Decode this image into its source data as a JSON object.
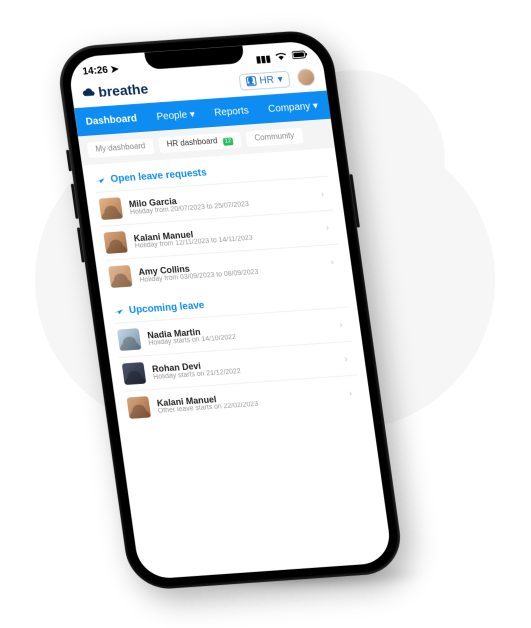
{
  "status_bar": {
    "time": "14:26",
    "location_icon": "location-arrow",
    "signal_icon": "signal",
    "wifi_icon": "wifi",
    "battery_icon": "battery"
  },
  "header": {
    "brand": "breathe",
    "role_selector": {
      "icon": "person",
      "label": "HR",
      "caret": "▾"
    }
  },
  "nav": {
    "items": [
      {
        "label": "Dashboard",
        "active": true
      },
      {
        "label": "People ▾"
      },
      {
        "label": "Reports"
      },
      {
        "label": "Company ▾"
      }
    ]
  },
  "sub_tabs": {
    "items": [
      {
        "label": "My dashboard",
        "active": false
      },
      {
        "label": "HR dashboard",
        "active": true,
        "badge": "12"
      },
      {
        "label": "Community",
        "active": false
      }
    ]
  },
  "sections": [
    {
      "icon": "plane",
      "title": "Open leave requests",
      "rows": [
        {
          "name": "Milo Garcia",
          "sub": "Holiday from 20/07/2023 to 25/07/2023",
          "avatar": "a1"
        },
        {
          "name": "Kalani Manuel",
          "sub": "Holiday from 12/11/2023 to 14/11/2023",
          "avatar": "a2"
        },
        {
          "name": "Amy Collins",
          "sub": "Holiday from 03/09/2023 to 08/09/2023",
          "avatar": "a3"
        }
      ]
    },
    {
      "icon": "plane",
      "title": "Upcoming leave",
      "rows": [
        {
          "name": "Nadia Martin",
          "sub": "Holiday starts on 14/10/2022",
          "avatar": "a4"
        },
        {
          "name": "Rohan Devi",
          "sub": "Holiday starts on 21/12/2022",
          "avatar": "a5"
        },
        {
          "name": "Kalani Manuel",
          "sub": "Other leave starts on 22/02/2023",
          "avatar": "a2"
        }
      ]
    }
  ],
  "icons": {
    "chevron": "›"
  }
}
